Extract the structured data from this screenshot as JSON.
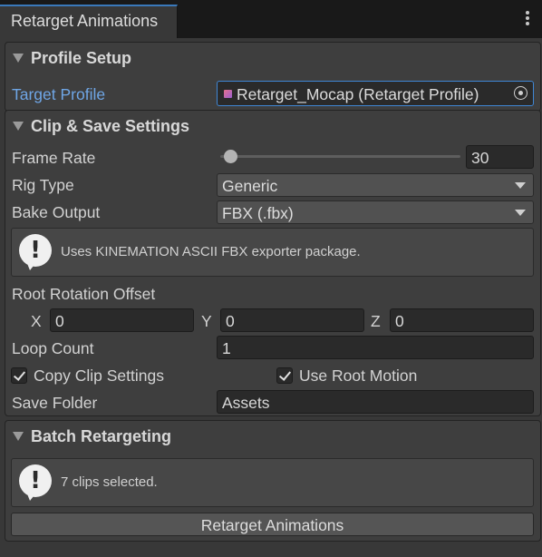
{
  "window": {
    "tab_title": "Retarget Animations",
    "menu_icon": "kebab-menu-icon"
  },
  "profile_setup": {
    "title": "Profile Setup",
    "target_profile_label": "Target Profile",
    "target_profile_value": "Retarget_Mocap (Retarget Profile)"
  },
  "clip_save": {
    "title": "Clip & Save Settings",
    "frame_rate_label": "Frame Rate",
    "frame_rate_value": "30",
    "rig_type_label": "Rig Type",
    "rig_type_value": "Generic",
    "bake_output_label": "Bake Output",
    "bake_output_value": "FBX (.fbx)",
    "help_text": "Uses KINEMATION ASCII FBX exporter package.",
    "root_rotation_label": "Root Rotation Offset",
    "x_label": "X",
    "x_value": "0",
    "y_label": "Y",
    "y_value": "0",
    "z_label": "Z",
    "z_value": "0",
    "loop_count_label": "Loop Count",
    "loop_count_value": "1",
    "copy_clip_label": "Copy Clip Settings",
    "copy_clip_checked": true,
    "use_root_motion_label": "Use Root Motion",
    "use_root_motion_checked": true,
    "save_folder_label": "Save Folder",
    "save_folder_value": "Assets"
  },
  "batch": {
    "title": "Batch Retargeting",
    "help_text": "7 clips selected.",
    "button_label": "Retarget Animations"
  },
  "colors": {
    "accent": "#3a79bb",
    "link_label": "#6fa6e6",
    "panel_bg": "#3e3e3e",
    "field_bg": "#2a2a2a"
  }
}
